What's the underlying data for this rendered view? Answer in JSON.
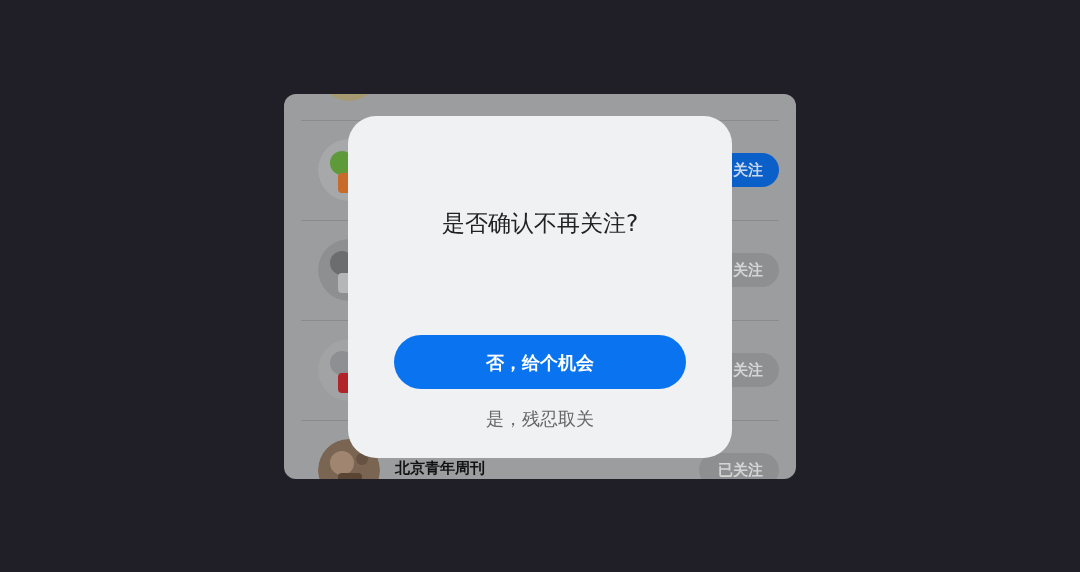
{
  "list": [
    {
      "follow_button": {
        "label": "关注",
        "highlighted": true
      }
    },
    {
      "follow_button": {
        "label": "关注",
        "highlighted": false
      }
    },
    {
      "follow_button": {
        "label": "关注",
        "highlighted": false
      }
    },
    {
      "name": "北京青年周刊",
      "follow_button": {
        "label": "已关注",
        "highlighted": false
      }
    }
  ],
  "dialog": {
    "title": "是否确认不再关注?",
    "confirm_button": "否，给个机会",
    "cancel_link": "是，残忍取关"
  }
}
